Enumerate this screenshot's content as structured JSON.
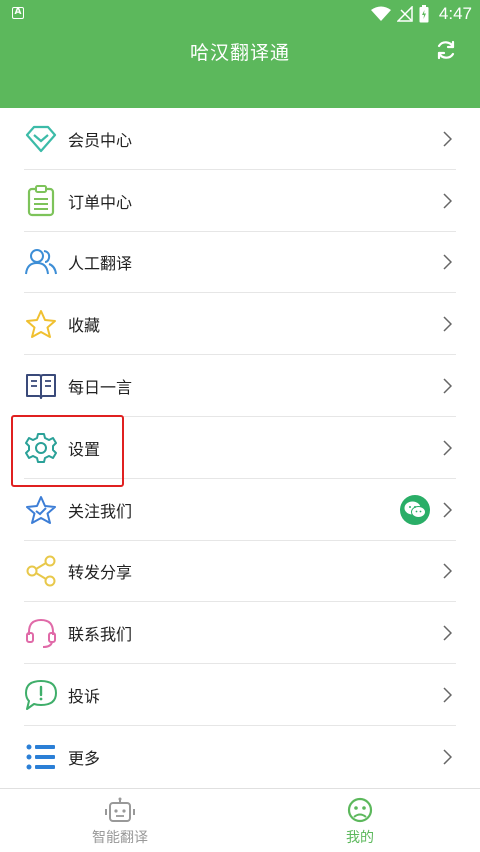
{
  "status_bar": {
    "time": "4:47",
    "app_badge": "A"
  },
  "header": {
    "title": "哈汉翻译通",
    "refresh_icon": "refresh-icon",
    "background": "#5cb85c"
  },
  "menu": {
    "items": [
      {
        "label": "会员中心",
        "icon": "diamond-icon"
      },
      {
        "label": "订单中心",
        "icon": "clipboard-icon"
      },
      {
        "label": "人工翻译",
        "icon": "people-icon"
      },
      {
        "label": "收藏",
        "icon": "star-icon"
      },
      {
        "label": "每日一言",
        "icon": "book-icon"
      },
      {
        "label": "设置",
        "icon": "gear-icon"
      },
      {
        "label": "关注我们",
        "icon": "star-badge-icon"
      },
      {
        "label": "转发分享",
        "icon": "share-icon"
      },
      {
        "label": "联系我们",
        "icon": "headset-icon"
      },
      {
        "label": "投诉",
        "icon": "complaint-icon"
      },
      {
        "label": "更多",
        "icon": "list-icon"
      }
    ]
  },
  "bottom_nav": {
    "tabs": [
      {
        "label": "智能翻译",
        "icon": "robot-icon",
        "active": false
      },
      {
        "label": "我的",
        "icon": "face-icon",
        "active": true
      }
    ]
  },
  "colors": {
    "accent": "#5cb85c",
    "highlight": "#e02020",
    "wechat": "#2aae67"
  }
}
